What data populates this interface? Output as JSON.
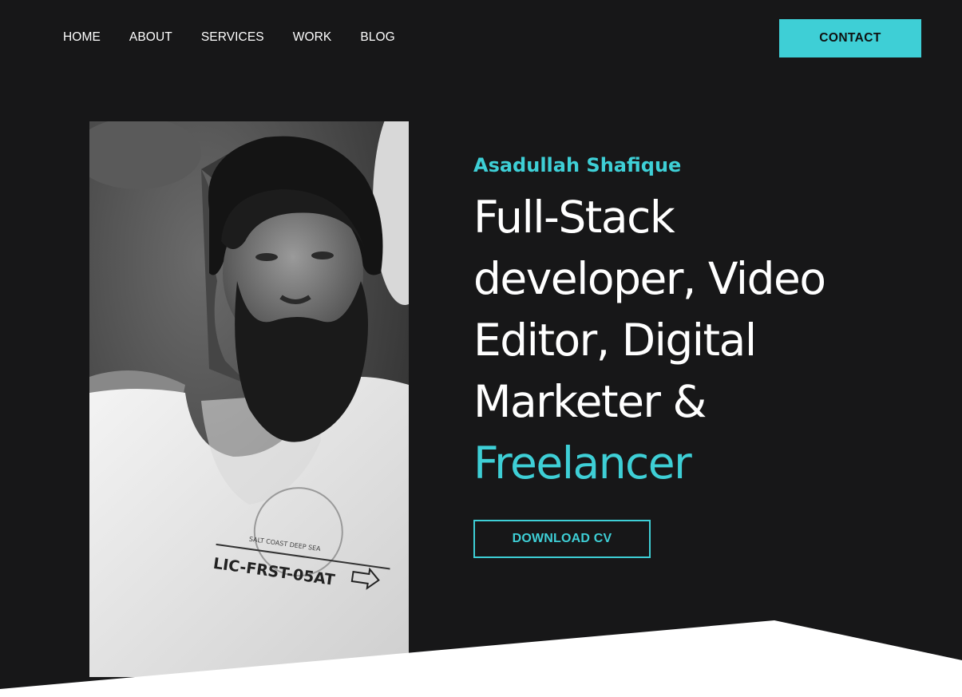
{
  "nav": {
    "links": [
      {
        "label": "HOME"
      },
      {
        "label": "ABOUT"
      },
      {
        "label": "SERVICES"
      },
      {
        "label": "WORK"
      },
      {
        "label": "BLOG"
      }
    ],
    "contact_label": "CONTACT"
  },
  "hero": {
    "name": "Asadullah Shafique",
    "title_lines": [
      "Full-Stack",
      "developer, Video",
      "Editor, Digital",
      "Marketer &"
    ],
    "title_accent": "Freelancer",
    "cv_label": "DOWNLOAD CV"
  },
  "photo": {
    "shirt_text": "LIC-FRST-05AT",
    "shirt_subtext": "SALT COAST DEEP SEA"
  },
  "colors": {
    "background": "#171718",
    "accent": "#3ecfd6",
    "text": "#ffffff",
    "bottom": "#ffffff"
  }
}
